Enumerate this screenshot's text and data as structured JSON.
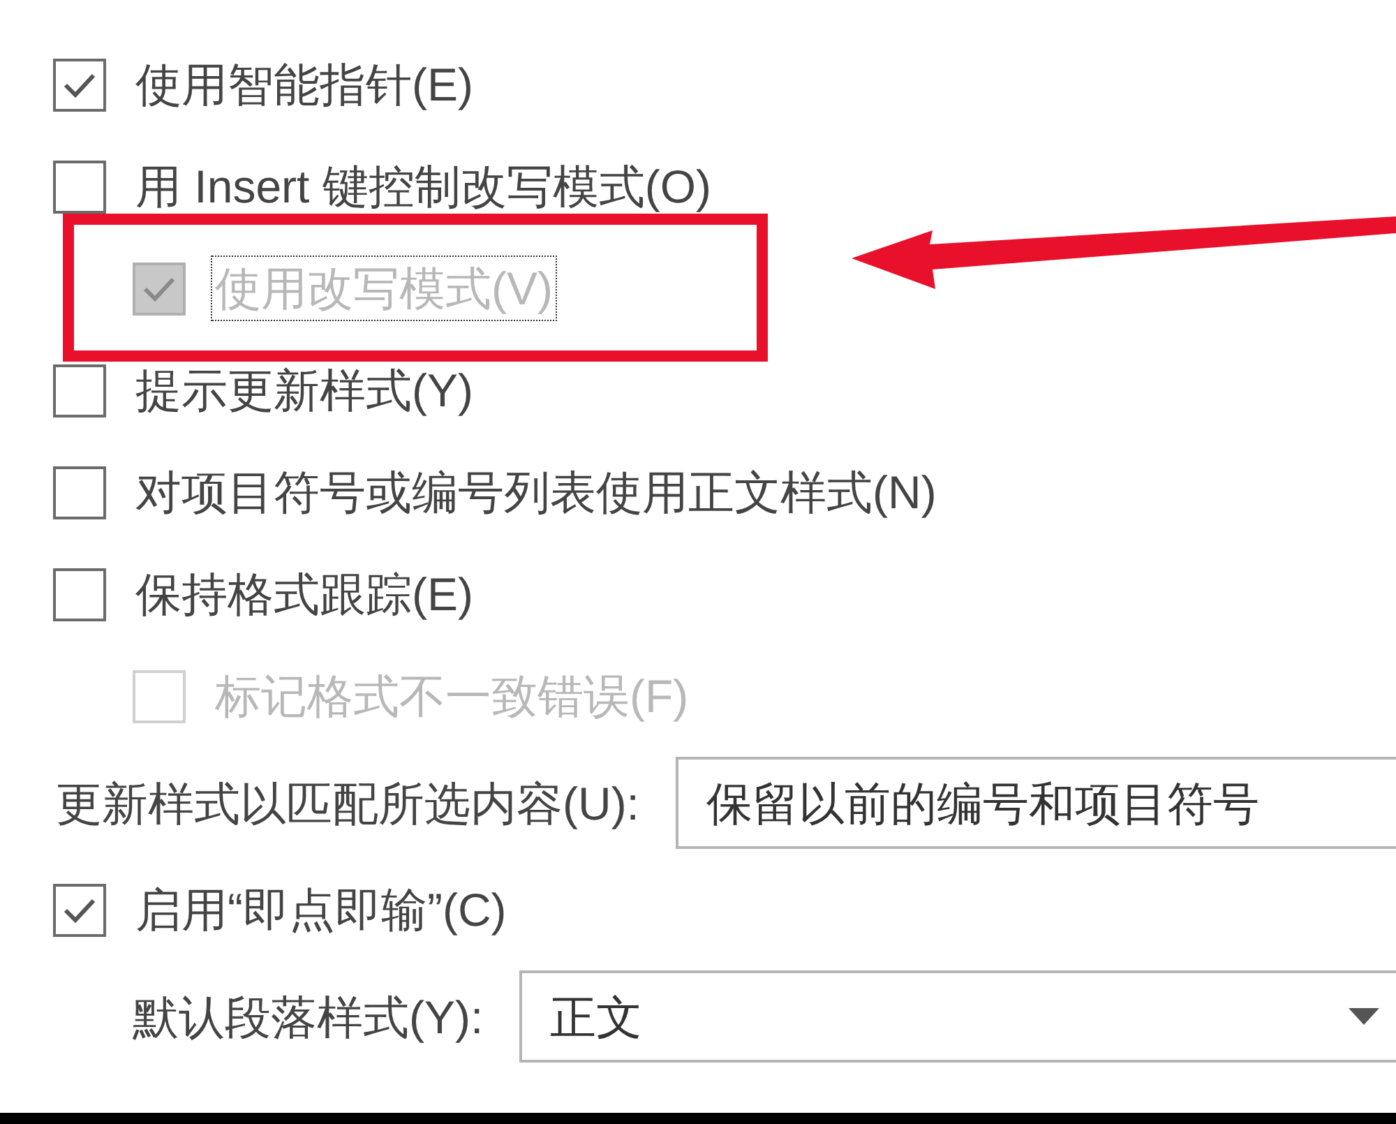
{
  "options": [
    {
      "kind": "checkbox",
      "label": "使用智能指针(E)",
      "checked": true,
      "disabled": false,
      "focused": false
    },
    {
      "kind": "checkbox",
      "label": "用 Insert 键控制改写模式(O)",
      "checked": false,
      "disabled": false,
      "focused": false,
      "children": [
        {
          "kind": "checkbox",
          "label": "使用改写模式(V)",
          "checked": true,
          "disabled": true,
          "focused": true
        }
      ]
    },
    {
      "kind": "checkbox",
      "label": "提示更新样式(Y)",
      "checked": false,
      "disabled": false,
      "focused": false
    },
    {
      "kind": "checkbox",
      "label": "对项目符号或编号列表使用正文样式(N)",
      "checked": false,
      "disabled": false,
      "focused": false
    },
    {
      "kind": "checkbox",
      "label": "保持格式跟踪(E)",
      "checked": false,
      "disabled": false,
      "focused": false,
      "children": [
        {
          "kind": "checkbox",
          "label": "标记格式不一致错误(F)",
          "checked": false,
          "disabled": true,
          "focused": false
        }
      ]
    },
    {
      "kind": "dropdown",
      "label": "更新样式以匹配所选内容(U):",
      "value": "保留以前的编号和项目符号",
      "caret": false
    },
    {
      "kind": "checkbox",
      "label": "启用“即点即输”(C)",
      "checked": true,
      "disabled": false,
      "focused": false,
      "children": [
        {
          "kind": "dropdown",
          "label": "默认段落样式(Y):",
          "value": "正文",
          "caret": true
        }
      ]
    }
  ]
}
